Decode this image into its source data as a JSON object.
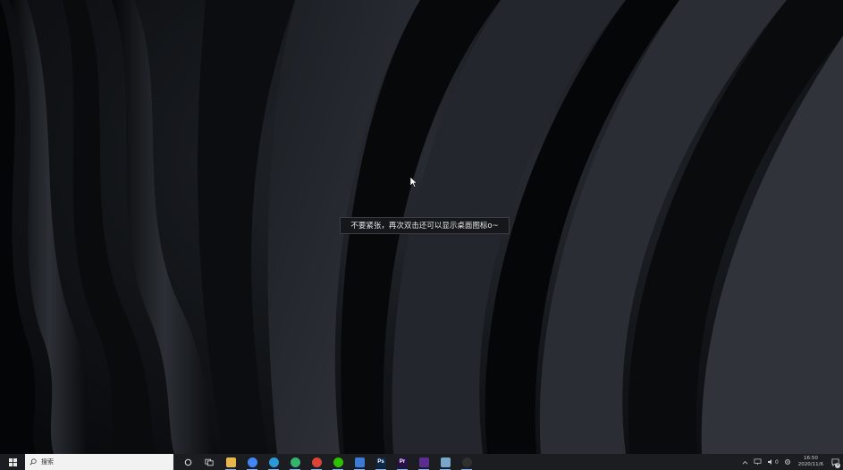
{
  "desktop": {
    "tooltip_text": "不要紧张，再次双击还可以显示桌面图标o~"
  },
  "taskbar": {
    "search_placeholder": "搜索",
    "apps": [
      {
        "name": "file-explorer",
        "glyph": "",
        "color": "#e8b74a"
      },
      {
        "name": "chrome",
        "glyph": "",
        "color": "#4285f4"
      },
      {
        "name": "edge",
        "glyph": "",
        "color": "#2a9bd8"
      },
      {
        "name": "edge-dev",
        "glyph": "",
        "color": "#34b46e"
      },
      {
        "name": "chrome-alt",
        "glyph": "",
        "color": "#db4437"
      },
      {
        "name": "wechat",
        "glyph": "",
        "color": "#2dc100"
      },
      {
        "name": "app-blue",
        "glyph": "",
        "color": "#3a7bd5"
      },
      {
        "name": "photoshop",
        "glyph": "Ps",
        "color": "#0b2a4a"
      },
      {
        "name": "premiere",
        "glyph": "Pr",
        "color": "#2a0f4a"
      },
      {
        "name": "visual-studio",
        "glyph": "",
        "color": "#5c2d91"
      },
      {
        "name": "notepad",
        "glyph": "",
        "color": "#7aa6c8"
      },
      {
        "name": "obs",
        "glyph": "",
        "color": "#303030"
      }
    ],
    "tray": {
      "clock_time": "16:50",
      "clock_date": "2020/11/6",
      "volume_label": "0",
      "notification_count": "3"
    }
  }
}
